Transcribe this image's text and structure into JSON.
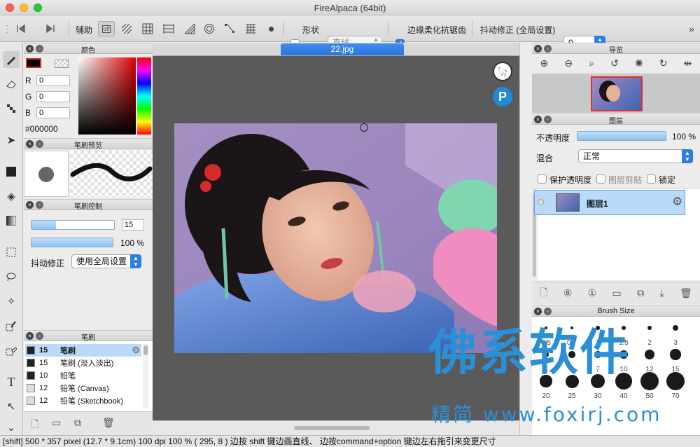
{
  "window": {
    "title": "FireAlpaca (64bit)"
  },
  "toolbar": {
    "assist_label": "辅助",
    "snap_off_label": "off",
    "shape_label": "形状",
    "shape_value": "直线",
    "antialias_label": "边缘柔化抗锯齿",
    "stabilizer_label": "抖动修正 (全局设置)",
    "stabilizer_value": "0"
  },
  "panels": {
    "color": {
      "title": "颜色",
      "r_label": "R",
      "g_label": "G",
      "b_label": "B",
      "r": "0",
      "g": "0",
      "b": "0",
      "hex": "#000000"
    },
    "brush_preview": {
      "title": "笔刷预览"
    },
    "brush_control": {
      "title": "笔刷控制",
      "size": "15",
      "opacity_text": "100 %",
      "opacity_fraction": 1.0,
      "size_fraction": 0.3,
      "stabilizer_label": "抖动修正",
      "stabilizer_value": "使用全局设置"
    },
    "brush": {
      "title": "笔刷",
      "items": [
        {
          "size": "15",
          "name": "笔刷"
        },
        {
          "size": "15",
          "name": "笔刷 (淡入淡出)"
        },
        {
          "size": "10",
          "name": "铅笔"
        },
        {
          "size": "12",
          "name": "铅笔 (Canvas)"
        },
        {
          "size": "12",
          "name": "铅笔 (Sketchbook)"
        }
      ]
    },
    "navigator": {
      "title": "导览"
    },
    "layer": {
      "title": "图层",
      "opacity_label": "不透明度",
      "opacity_text": "100 %",
      "blend_label": "混合",
      "blend_value": "正常",
      "protect_alpha_label": "保护透明度",
      "clipping_label": "图层剪贴",
      "lock_label": "锁定",
      "layers": [
        {
          "name": "图层1"
        }
      ]
    },
    "brush_size": {
      "title": "Brush Size",
      "labels": [
        "0.5",
        "0.7",
        "1",
        "1.5",
        "2",
        "3",
        "4",
        "5",
        "7",
        "10",
        "12",
        "15",
        "20",
        "25",
        "30",
        "40",
        "50",
        "70"
      ]
    }
  },
  "document": {
    "tab_label": "22.jpg"
  },
  "watermark": {
    "main": "佛系软件",
    "sub": "精简 www.foxirj.com"
  },
  "status": {
    "text": "[shift]    500 * 357 pixel    (12.7 * 9.1cm)    100 dpi    100 %    ( 295, 8 )    边按 shift 键边画直线、 边按command+option 键边左右拖引来变更尺寸"
  },
  "colors": {
    "accent": "#2f7de1",
    "current_color": "#000000",
    "watermark": "#2b8fd6"
  }
}
